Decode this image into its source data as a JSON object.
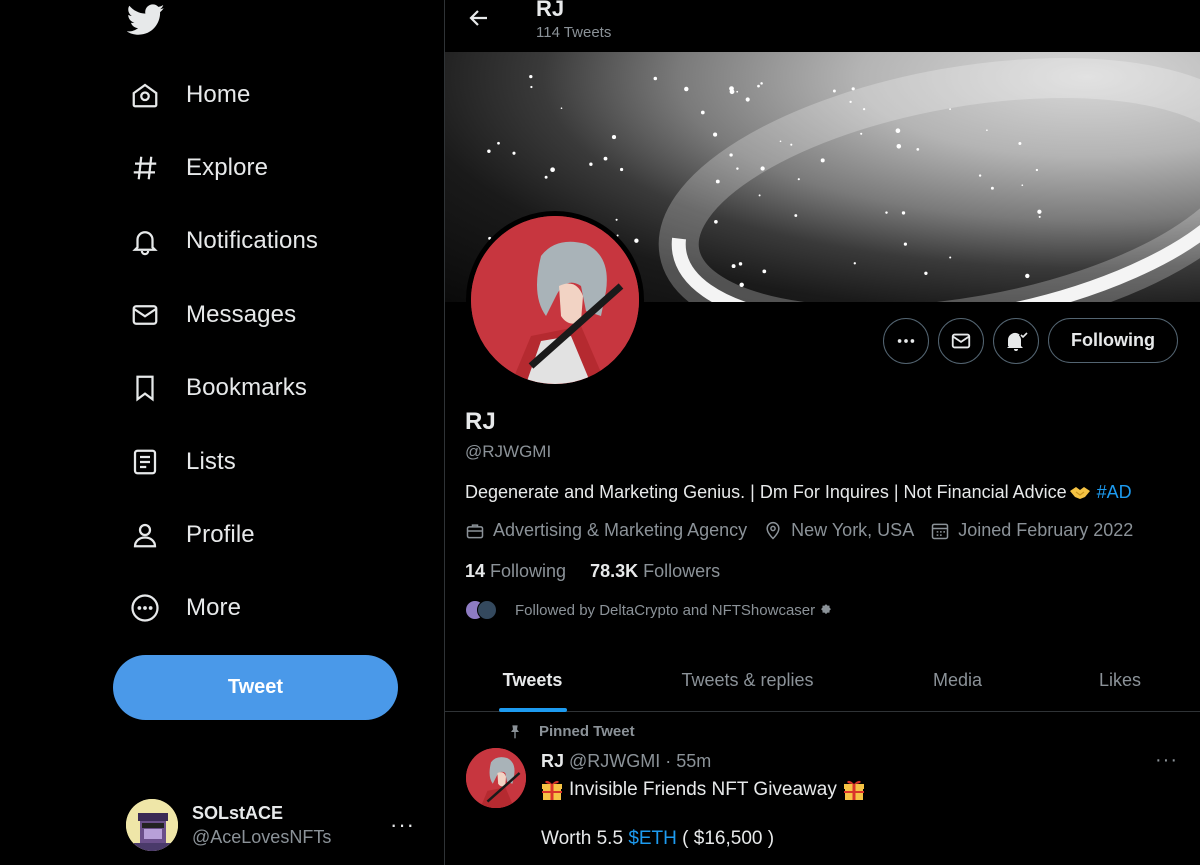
{
  "sidebar": {
    "logo_icon": "twitter-bird-icon",
    "nav": [
      {
        "label": "Home",
        "icon": "home-icon"
      },
      {
        "label": "Explore",
        "icon": "hashtag-icon"
      },
      {
        "label": "Notifications",
        "icon": "bell-icon"
      },
      {
        "label": "Messages",
        "icon": "envelope-icon"
      },
      {
        "label": "Bookmarks",
        "icon": "bookmark-icon"
      },
      {
        "label": "Lists",
        "icon": "list-icon"
      },
      {
        "label": "Profile",
        "icon": "person-icon"
      },
      {
        "label": "More",
        "icon": "more-circle-icon"
      }
    ],
    "tweet_button": "Tweet",
    "account": {
      "name": "SOLstACE",
      "handle": "@AceLovesNFTs",
      "more": "···"
    }
  },
  "header": {
    "title": "RJ",
    "subtitle": "114 Tweets"
  },
  "profile": {
    "name": "RJ",
    "handle": "@RJWGMI",
    "bio_text": "Degenerate and Marketing Genius. | Dm For Inquires | Not Financial Advice",
    "bio_hashtag": "#AD",
    "category": "Advertising & Marketing Agency",
    "location": "New York, USA",
    "joined": "Joined February 2022",
    "following_count": "14",
    "following_label": "Following",
    "followers_count": "78.3K",
    "followers_label": "Followers",
    "followed_by": "Followed by DeltaCrypto and NFTShowcaser",
    "following_button": "Following"
  },
  "tabs": [
    {
      "label": "Tweets",
      "active": true
    },
    {
      "label": "Tweets & replies",
      "active": false
    },
    {
      "label": "Media",
      "active": false
    },
    {
      "label": "Likes",
      "active": false
    }
  ],
  "pinned_tweet": {
    "pinned_label": "Pinned Tweet",
    "author_name": "RJ",
    "author_meta": "@RJWGMI · 55m",
    "line1": "Invisible Friends NFT Giveaway",
    "line2_prefix": "Worth 5.5 ",
    "line2_cashtag": "$ETH",
    "line2_suffix": " ( $16,500 )",
    "more": "···"
  },
  "colors": {
    "accent": "#1d9bf0",
    "tweet_button": "#4a99e9",
    "background": "#000000",
    "muted": "#8b9298"
  }
}
